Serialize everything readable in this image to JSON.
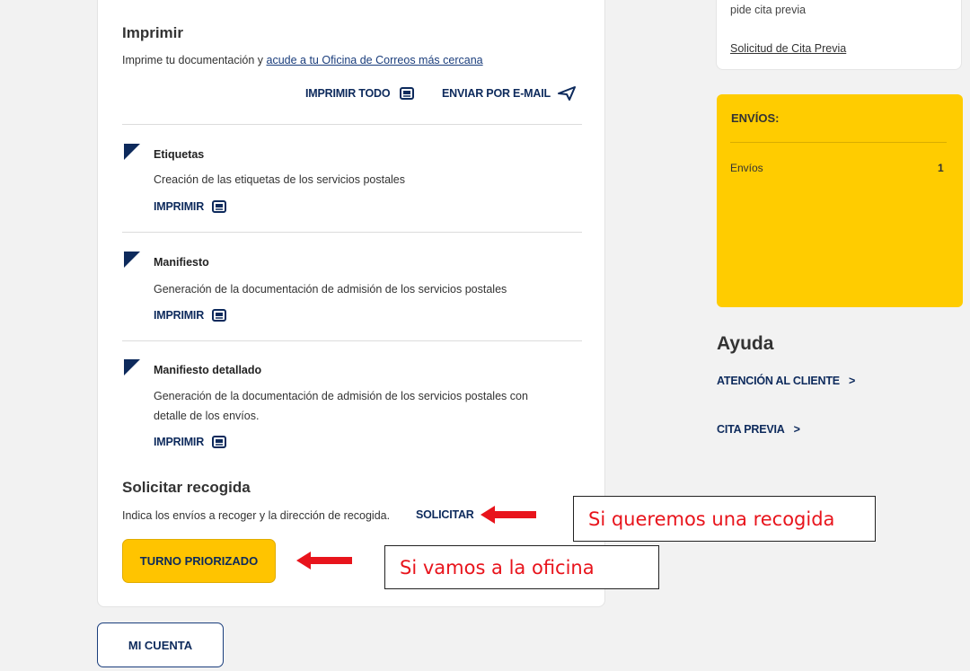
{
  "print_section": {
    "title": "Imprimir",
    "description": "Imprime tu documentación y",
    "office_link": "acude a tu Oficina de Correos más cercana",
    "print_all_label": "IMPRIMIR TODO",
    "send_email_label": "ENVIAR POR E-MAIL"
  },
  "documents": [
    {
      "title": "Etiquetas",
      "description": "Creación de las etiquetas de los servicios postales",
      "action_label": "IMPRIMIR"
    },
    {
      "title": "Manifiesto",
      "description": "Generación de la documentación de admisión de los servicios postales",
      "action_label": "IMPRIMIR"
    },
    {
      "title": "Manifiesto detallado",
      "description_line1": "Generación de la documentación de admisión de los servicios postales con",
      "description_line2": "detalle de los envíos.",
      "action_label": "IMPRIMIR"
    }
  ],
  "pickup": {
    "title": "Solicitar recogida",
    "description": "Indica los envíos a recoger y la dirección de recogida.",
    "request_label": "SOLICITAR",
    "priority_turn_label": "TURNO PRIORIZADO"
  },
  "account_button_label": "MI CUENTA",
  "right_panel": {
    "appointment_text": "pide cita previa",
    "appointment_link": "Solicitud de Cita Previa",
    "shipments": {
      "title": "ENVÍOS:",
      "row_label": "Envíos",
      "row_count": "1"
    },
    "help": {
      "title": "Ayuda",
      "customer_service": "ATENCIÓN AL CLIENTE",
      "appointment": "CITA PREVIA",
      "chevron": ">"
    }
  },
  "annotations": {
    "pickup_note": "Si queremos una recogida",
    "office_note": "Si vamos a la oficina"
  },
  "colors": {
    "brand_yellow": "#ffcc00",
    "brand_navy": "#0d2a5c",
    "annotation_red": "#e8141c"
  },
  "icons": [
    "printer-icon",
    "send-icon",
    "flag-corner-icon",
    "arrow-left-icon"
  ]
}
